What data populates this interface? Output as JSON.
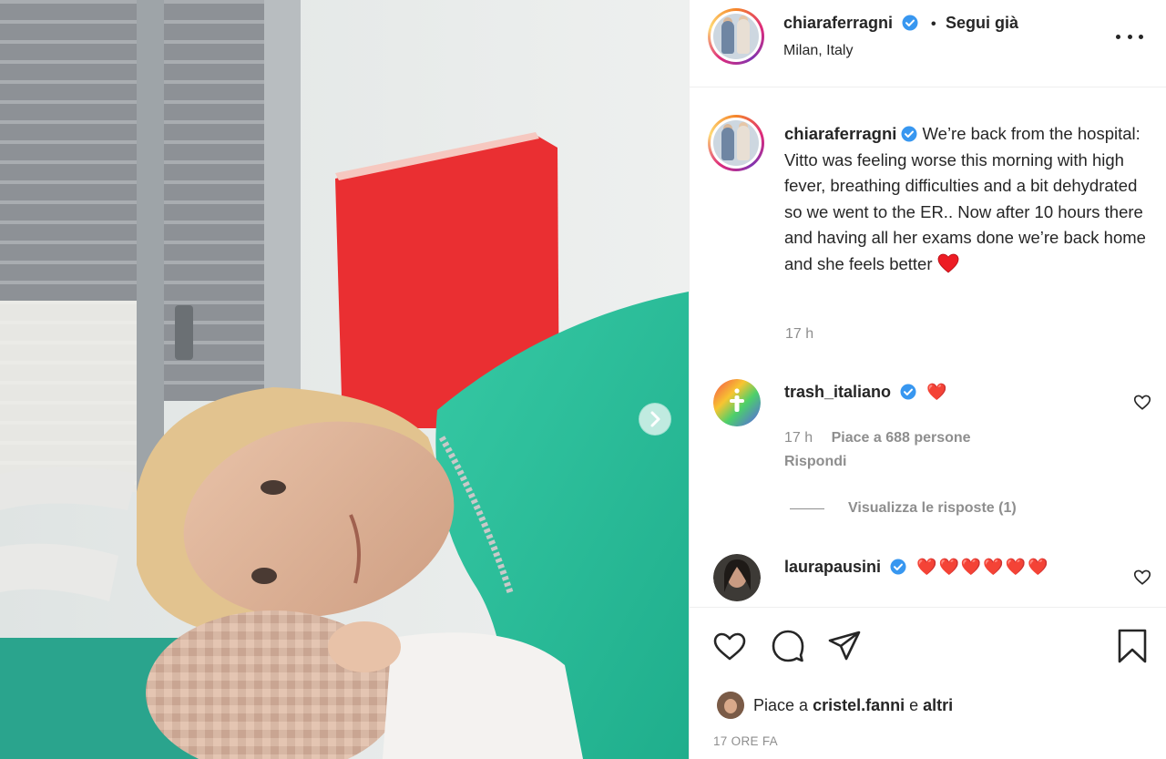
{
  "post": {
    "username": "chiaraferragni",
    "follow_state": "Segui già",
    "location": "Milan, Italy",
    "caption": "We’re back from the hospital: Vitto was feeling worse this morning with high fever, breathing difficulties and a bit dehydrated so we went to the ER.. Now after 10 hours there and having all her exams done we’re back home and she feels better",
    "caption_time": "17 h",
    "likes_prefix": "Piace a",
    "likes_user": "cristel.fanni",
    "likes_joiner": "e",
    "likes_suffix": "altri",
    "post_time": "17 ORE FA"
  },
  "comments": [
    {
      "username": "trash_italiano",
      "text": "❤️",
      "time": "17 h",
      "likes": "Piace a 688 persone",
      "reply_label": "Rispondi",
      "view_replies": "Visualizza le risposte (1)"
    },
    {
      "username": "laurapausini",
      "text": "❤️❤️❤️❤️❤️❤️"
    }
  ],
  "icons": {
    "verified": "verified-badge-icon",
    "more": "more-options-icon",
    "like": "heart-icon",
    "comment": "comment-bubble-icon",
    "share": "paper-plane-icon",
    "save": "bookmark-icon",
    "next": "chevron-right-icon"
  },
  "colors": {
    "verified_blue": "#3897f0",
    "heart_red": "#ed1c24",
    "text": "#262626",
    "muted": "#8e8e8e"
  }
}
